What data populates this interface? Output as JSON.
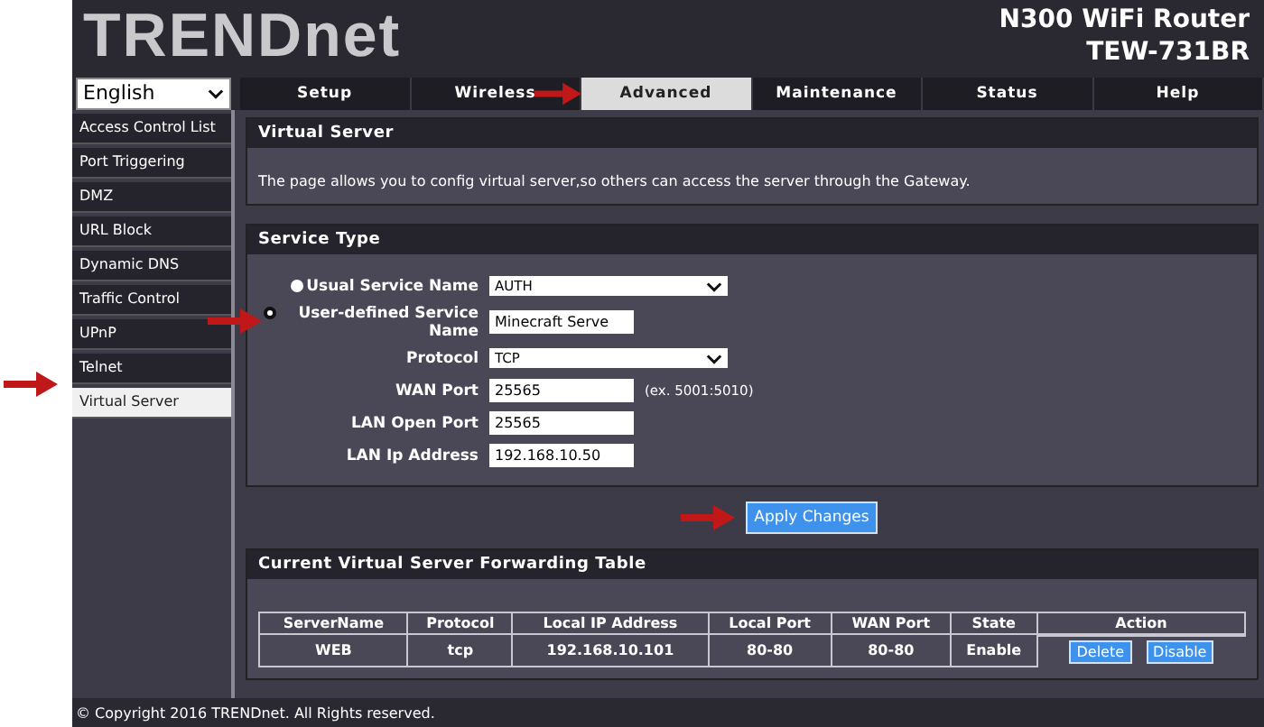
{
  "header": {
    "logo": "TRENDnet",
    "product": "N300 WiFi Router",
    "model": "TEW-731BR"
  },
  "language": {
    "value": "English"
  },
  "tabs": [
    {
      "label": "Setup",
      "selected": false
    },
    {
      "label": "Wireless",
      "selected": false
    },
    {
      "label": "Advanced",
      "selected": true
    },
    {
      "label": "Maintenance",
      "selected": false
    },
    {
      "label": "Status",
      "selected": false
    },
    {
      "label": "Help",
      "selected": false
    }
  ],
  "sidebar": {
    "items": [
      {
        "label": "Access Control List",
        "selected": false
      },
      {
        "label": "Port Triggering",
        "selected": false
      },
      {
        "label": "DMZ",
        "selected": false
      },
      {
        "label": "URL Block",
        "selected": false
      },
      {
        "label": "Dynamic DNS",
        "selected": false
      },
      {
        "label": "Traffic Control",
        "selected": false
      },
      {
        "label": "UPnP",
        "selected": false
      },
      {
        "label": "Telnet",
        "selected": false
      },
      {
        "label": "Virtual Server",
        "selected": true
      }
    ]
  },
  "intro": {
    "title": "Virtual Server",
    "text": "The page allows you to config virtual server,so others can access the server through the Gateway."
  },
  "service_type": {
    "title": "Service Type",
    "rows": [
      {
        "kind": "radio-select",
        "label": "Usual Service Name",
        "selected": false,
        "value": "AUTH"
      },
      {
        "kind": "radio-text",
        "label": "User-defined Service Name",
        "selected": true,
        "value": "Minecraft Serve"
      },
      {
        "kind": "select",
        "label": "Protocol",
        "value": "TCP"
      },
      {
        "kind": "text",
        "label": "WAN Port",
        "value": "25565",
        "hint": "(ex. 5001:5010)"
      },
      {
        "kind": "text",
        "label": "LAN Open Port",
        "value": "25565"
      },
      {
        "kind": "text",
        "label": "LAN Ip Address",
        "value": "192.168.10.50"
      }
    ]
  },
  "apply_button": "Apply Changes",
  "table": {
    "title": "Current Virtual Server Forwarding Table",
    "columns": [
      "ServerName",
      "Protocol",
      "Local IP Address",
      "Local Port",
      "WAN Port",
      "State",
      "Action"
    ],
    "rows": [
      {
        "cells": [
          "WEB",
          "tcp",
          "192.168.10.101",
          "80-80",
          "80-80",
          "Enable"
        ],
        "actions": [
          "Delete",
          "Disable"
        ]
      }
    ]
  },
  "footer": "© Copyright 2016 TRENDnet. All Rights reserved."
}
